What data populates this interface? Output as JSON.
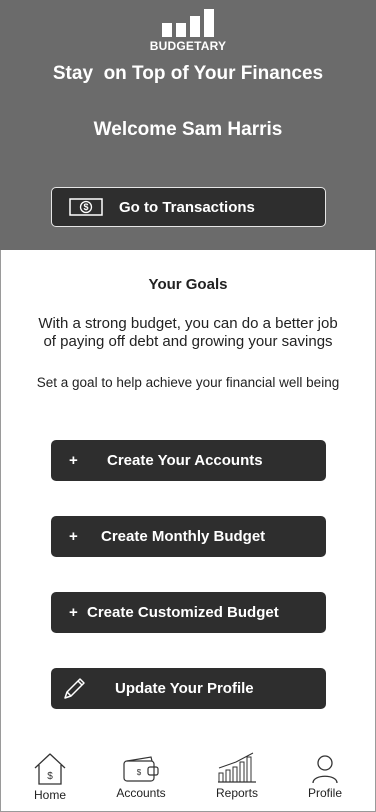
{
  "app": {
    "logo_text": "BUDGETARY",
    "logo_bar_levels": [
      0.5,
      0.5,
      0.75,
      1.0
    ]
  },
  "hero": {
    "tagline": "Stay  on Top of Your Finances",
    "welcome": "Welcome Sam Harris",
    "transactions_button": "Go to Transactions",
    "transactions_icon": "dollar-bill-icon"
  },
  "goals": {
    "title": "Your Goals",
    "description": "With a strong budget, you can do a better job of paying off debt and growing your savings",
    "subtitle": "Set a goal to help achieve your financial well being"
  },
  "actions": [
    {
      "icon": "+",
      "label": "Create Your Accounts"
    },
    {
      "icon": "+",
      "label": "Create Monthly Budget"
    },
    {
      "icon": "+",
      "label": "Create Customized Budget"
    },
    {
      "icon": "pencil-icon",
      "label": "Update Your Profile"
    }
  ],
  "tabs": [
    {
      "label": "Home",
      "icon": "home-icon",
      "active": true
    },
    {
      "label": "Accounts",
      "icon": "wallet-icon",
      "active": false
    },
    {
      "label": "Reports",
      "icon": "bar-chart-icon",
      "active": false
    },
    {
      "label": "Profile",
      "icon": "person-icon",
      "active": false
    }
  ],
  "colors": {
    "hero_background": "#6b6b6b",
    "button_background": "#2e2e2e",
    "text_on_dark": "#ffffff",
    "body_text": "#222222"
  }
}
